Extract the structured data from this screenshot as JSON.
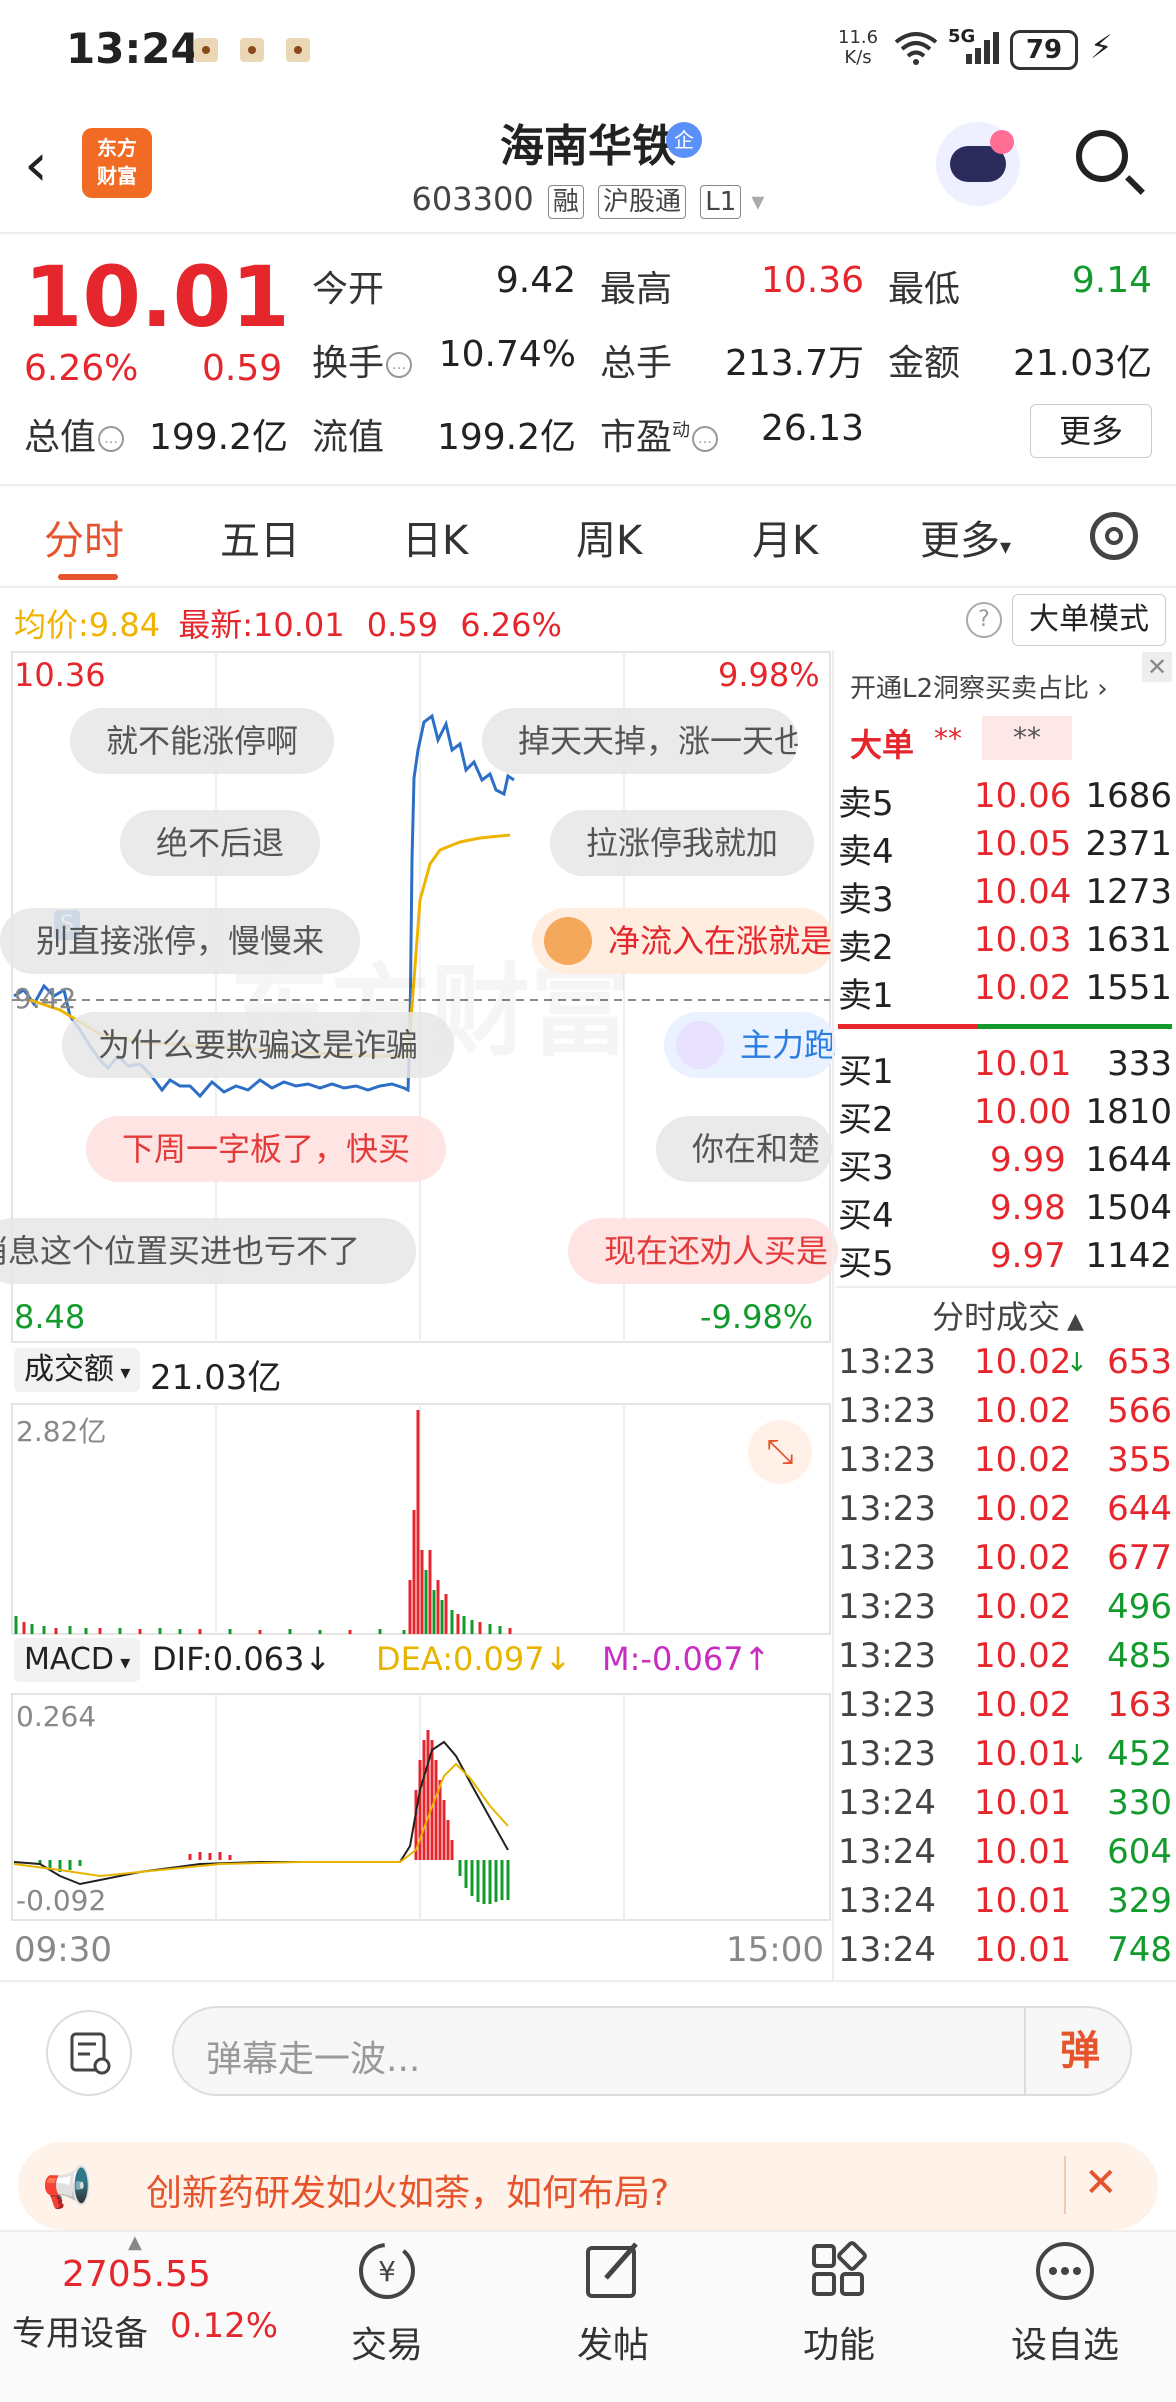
{
  "status_bar": {
    "time": "13:24",
    "net_speed_value": "11.6",
    "net_speed_unit": "K/s",
    "network": "5G",
    "battery": "79"
  },
  "header": {
    "logo_line1": "东方",
    "logo_line2": "财富",
    "stock_name": "海南华铁",
    "stock_badge": "企",
    "code": "603300",
    "tags": [
      "融",
      "沪股通",
      "L1"
    ]
  },
  "quote": {
    "price": "10.01",
    "pct": "6.26%",
    "change": "0.59",
    "fields": [
      {
        "label": "今开",
        "value": "9.42",
        "color": "dark"
      },
      {
        "label": "最高",
        "value": "10.36",
        "color": "red"
      },
      {
        "label": "最低",
        "value": "9.14",
        "color": "green"
      },
      {
        "label": "换手",
        "value": "10.74%",
        "color": "dark"
      },
      {
        "label": "总手",
        "value": "213.7万",
        "color": "dark"
      },
      {
        "label": "金额",
        "value": "21.03亿",
        "color": "dark"
      },
      {
        "label": "总值",
        "value": "199.2亿",
        "color": "dark"
      },
      {
        "label": "流值",
        "value": "199.2亿",
        "color": "dark"
      },
      {
        "label": "市盈",
        "value": "26.13",
        "color": "dark"
      }
    ],
    "pe_superscript": "动",
    "more_button": "更多"
  },
  "tabs": [
    "分时",
    "五日",
    "日K",
    "周K",
    "月K",
    "更多"
  ],
  "avg_bar": {
    "avg_label": "均价:",
    "avg_value": "9.84",
    "latest_label": "最新:",
    "latest_value": "10.01",
    "change": "0.59",
    "pct": "6.26%",
    "help": "?",
    "big_order_mode": "大单模式"
  },
  "chart": {
    "y_high": "10.36",
    "pct_high": "9.98%",
    "y_low": "8.48",
    "pct_low": "-9.98%",
    "open_label": "9.42",
    "start_marker": "S",
    "watermark": "东方财富",
    "volume_label": "成交额",
    "volume_total": "21.03亿",
    "volume_max": "2.82亿",
    "macd_label": "MACD",
    "dif": "DIF:0.063↓",
    "dea": "DEA:0.097↓",
    "m": "M:-0.067↑",
    "macd_high": "0.264",
    "macd_low": "-0.092",
    "time_start": "09:30",
    "time_end": "15:00"
  },
  "danmaku": [
    {
      "text": "就不能涨停啊",
      "style": "gray"
    },
    {
      "text": "掉天天掉，涨一天也",
      "style": "gray"
    },
    {
      "text": "绝不后退",
      "style": "gray"
    },
    {
      "text": "拉涨停我就加",
      "style": "gray"
    },
    {
      "text": "别直接涨停，慢慢来",
      "style": "gray"
    },
    {
      "text": "净流入在涨就是",
      "style": "orange"
    },
    {
      "text": "为什么要欺骗这是诈骗",
      "style": "gray"
    },
    {
      "text": "主力跑",
      "style": "blue"
    },
    {
      "text": "下周一字板了，快买",
      "style": "pink"
    },
    {
      "text": "你在和楚",
      "style": "gray"
    },
    {
      "text": "消息这个位置买进也亏不了",
      "style": "gray"
    },
    {
      "text": "现在还劝人买是",
      "style": "pink"
    }
  ],
  "order_book": {
    "l2_link": "开通L2洞察买卖占比",
    "big_order_label": "大单",
    "big_order_mask1": "**",
    "big_order_mask2": "**",
    "asks": [
      {
        "label": "卖5",
        "price": "10.06",
        "vol": "1686"
      },
      {
        "label": "卖4",
        "price": "10.05",
        "vol": "2371"
      },
      {
        "label": "卖3",
        "price": "10.04",
        "vol": "1273"
      },
      {
        "label": "卖2",
        "price": "10.03",
        "vol": "1631"
      },
      {
        "label": "卖1",
        "price": "10.02",
        "vol": "1551"
      }
    ],
    "bids": [
      {
        "label": "买1",
        "price": "10.01",
        "vol": "333"
      },
      {
        "label": "买2",
        "price": "10.00",
        "vol": "1810"
      },
      {
        "label": "买3",
        "price": "9.99",
        "vol": "1644"
      },
      {
        "label": "买4",
        "price": "9.98",
        "vol": "1504"
      },
      {
        "label": "买5",
        "price": "9.97",
        "vol": "1142"
      }
    ]
  },
  "trades": {
    "title": "分时成交",
    "rows": [
      {
        "time": "13:23",
        "price": "10.02",
        "arrow": "↓",
        "vol": "653",
        "dir": "buy"
      },
      {
        "time": "13:23",
        "price": "10.02",
        "arrow": "",
        "vol": "566",
        "dir": "buy"
      },
      {
        "time": "13:23",
        "price": "10.02",
        "arrow": "",
        "vol": "355",
        "dir": "buy"
      },
      {
        "time": "13:23",
        "price": "10.02",
        "arrow": "",
        "vol": "644",
        "dir": "buy"
      },
      {
        "time": "13:23",
        "price": "10.02",
        "arrow": "",
        "vol": "677",
        "dir": "buy"
      },
      {
        "time": "13:23",
        "price": "10.02",
        "arrow": "",
        "vol": "496",
        "dir": "sell"
      },
      {
        "time": "13:23",
        "price": "10.02",
        "arrow": "",
        "vol": "485",
        "dir": "sell"
      },
      {
        "time": "13:23",
        "price": "10.02",
        "arrow": "",
        "vol": "163",
        "dir": "buy"
      },
      {
        "time": "13:23",
        "price": "10.01",
        "arrow": "↓",
        "vol": "452",
        "dir": "sell"
      },
      {
        "time": "13:24",
        "price": "10.01",
        "arrow": "",
        "vol": "330",
        "dir": "sell"
      },
      {
        "time": "13:24",
        "price": "10.01",
        "arrow": "",
        "vol": "604",
        "dir": "sell"
      },
      {
        "time": "13:24",
        "price": "10.01",
        "arrow": "",
        "vol": "329",
        "dir": "sell"
      },
      {
        "time": "13:24",
        "price": "10.01",
        "arrow": "",
        "vol": "748",
        "dir": "sell"
      }
    ]
  },
  "input": {
    "placeholder": "弹幕走一波...",
    "toggle": "弹"
  },
  "banner": {
    "text": "创新药研发如火如荼，如何布局?"
  },
  "bottom_nav": {
    "index_value": "2705.55",
    "index_label": "专用设备",
    "index_pct": "0.12%",
    "items": [
      {
        "label": "交易",
        "icon": "yen-cycle-icon"
      },
      {
        "label": "发帖",
        "icon": "edit-icon"
      },
      {
        "label": "功能",
        "icon": "grid-icon"
      },
      {
        "label": "设自选",
        "icon": "more-dots-icon"
      }
    ]
  },
  "colors": {
    "up": "#e5262c",
    "down": "#139a2c",
    "accent": "#e5542c",
    "avg_line": "#f0b400",
    "price_line": "#2d6fc7",
    "dif_line": "#222222",
    "dea_line": "#e8b400",
    "m_label": "#c82cc0"
  }
}
